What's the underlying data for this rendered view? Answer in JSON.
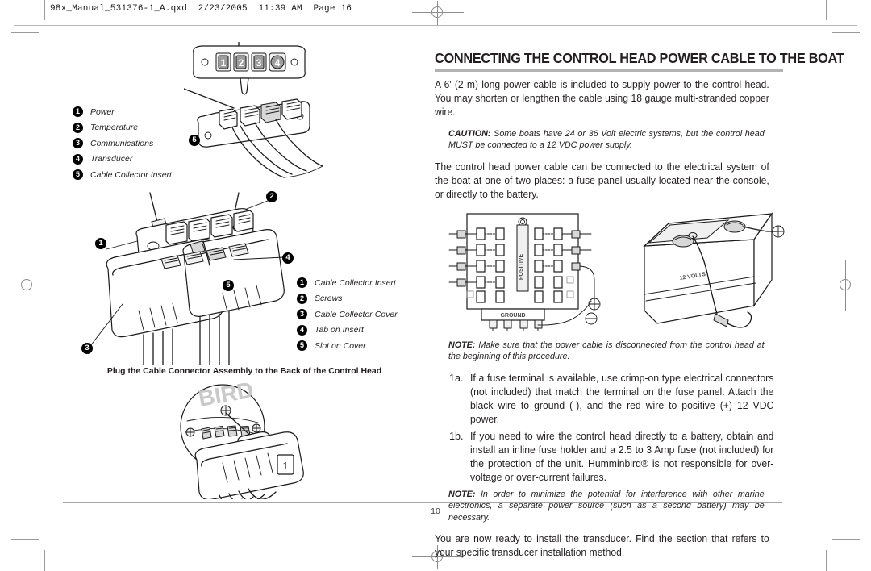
{
  "header": {
    "slug": "98x_Manual_531376-1_A.qxd  2/23/2005  11:39 AM  Page 16"
  },
  "footer": {
    "page_number": "10"
  },
  "left_column": {
    "connector_legend": [
      {
        "num": "1",
        "label": "Power"
      },
      {
        "num": "2",
        "label": "Temperature"
      },
      {
        "num": "3",
        "label": "Communications"
      },
      {
        "num": "4",
        "label": "Transducer"
      },
      {
        "num": "5",
        "label": "Cable Collector Insert"
      }
    ],
    "connector_ports": [
      "1",
      "2",
      "3",
      "4"
    ],
    "connector_callout": "5",
    "assembly_legend": [
      {
        "num": "1",
        "label": "Cable Collector Insert"
      },
      {
        "num": "2",
        "label": "Screws"
      },
      {
        "num": "3",
        "label": "Cable Collector Cover"
      },
      {
        "num": "4",
        "label": "Tab on Insert"
      },
      {
        "num": "5",
        "label": "Slot on Cover"
      }
    ],
    "assembly_callouts": [
      "1",
      "2",
      "3",
      "4",
      "5"
    ],
    "caption": "Plug the Cable Connector Assembly to the Back of the Control Head",
    "back_panel_port_label": "1"
  },
  "right_column": {
    "heading": "CONNECTING THE CONTROL HEAD POWER CABLE TO THE BOAT",
    "intro": "A 6' (2 m) long power cable is included to supply power to the control head. You may shorten or lengthen the cable using 18 gauge multi-stranded copper wire.",
    "caution": {
      "tag": "CAUTION:",
      "text": " Some boats have 24 or 36 Volt electric systems, but the control head MUST be connected to a 12 VDC power supply."
    },
    "places": "The control head power cable can be connected to the electrical system of the boat at one of two places: a fuse panel usually located near the console, or directly to the battery.",
    "figure": {
      "fuse_panel_positive": "POSITIVE",
      "fuse_panel_ground": "GROUND",
      "battery_label": "12 VOLTS"
    },
    "note_disconnect": {
      "tag": "NOTE:",
      "text": " Make sure that the power cable is disconnected from the control head at the beginning of this procedure."
    },
    "steps": [
      {
        "num": "1a.",
        "text": "If a fuse terminal is available, use crimp-on type electrical connectors (not included) that match the terminal on the fuse panel. Attach the black wire to ground (-), and the red wire to positive (+) 12 VDC power."
      },
      {
        "num": "1b.",
        "text": "If you need to wire the control head directly to a battery, obtain and install an inline fuse holder and a 2.5 to 3 Amp fuse (not included) for the protection of the unit. Humminbird® is not responsible for over-voltage or over-current failures."
      }
    ],
    "note_interference": {
      "tag": "NOTE:",
      "text": " In order to minimize the potential for interference with other marine electronics, a separate power source (such as a second battery) may be necessary."
    },
    "closing": "You are now ready to install the transducer. Find the section that refers to your specific transducer installation method."
  }
}
